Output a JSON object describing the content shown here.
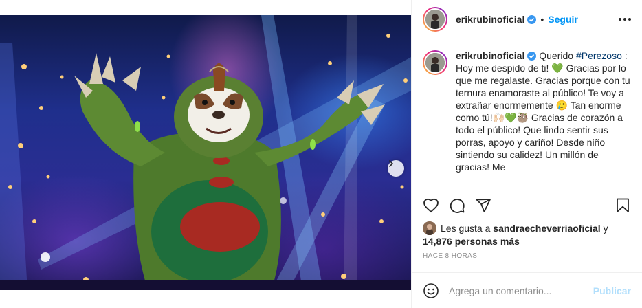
{
  "post": {
    "photo_alt": "",
    "carousel": {
      "slide_count": 2,
      "active_slide": 1
    }
  },
  "header": {
    "username": "erikrubinoficial",
    "separator": "•",
    "follow_label": "Seguir"
  },
  "caption": {
    "username": "erikrubinoficial",
    "intro": "Querido",
    "hashtag": "#Perezoso",
    "after_hashtag": ":",
    "line1": "Hoy me despido de ti! 💚 Gracias por lo que me regalaste. Gracias porque con tu ternura enamoraste al público! Te voy a extrañar enormemente 🥲 Tan enorme como tú!🙌🏻💚🦥",
    "line2": "Gracias de corazón a todo el público! Que lindo sentir sus porras, apoyo y cariño! Desde niño sintiendo su calidez! Un millón de gracias! Me"
  },
  "actions": {
    "like_icon": "heart-icon",
    "comment_icon": "comment-icon",
    "share_icon": "share-icon",
    "save_icon": "bookmark-icon"
  },
  "likes": {
    "prefix": "Les gusta a",
    "first_user": "sandraecheverriaoficial",
    "connector": "y",
    "others": "14,876 personas más"
  },
  "timestamp": "HACE 8 HORAS",
  "comment_box": {
    "placeholder": "Agrega un comentario...",
    "post_label": "Publicar"
  },
  "colors": {
    "accent": "#0095f6",
    "post_disabled": "#b2dffc",
    "muted": "#8e8e8e",
    "text": "#262626"
  }
}
